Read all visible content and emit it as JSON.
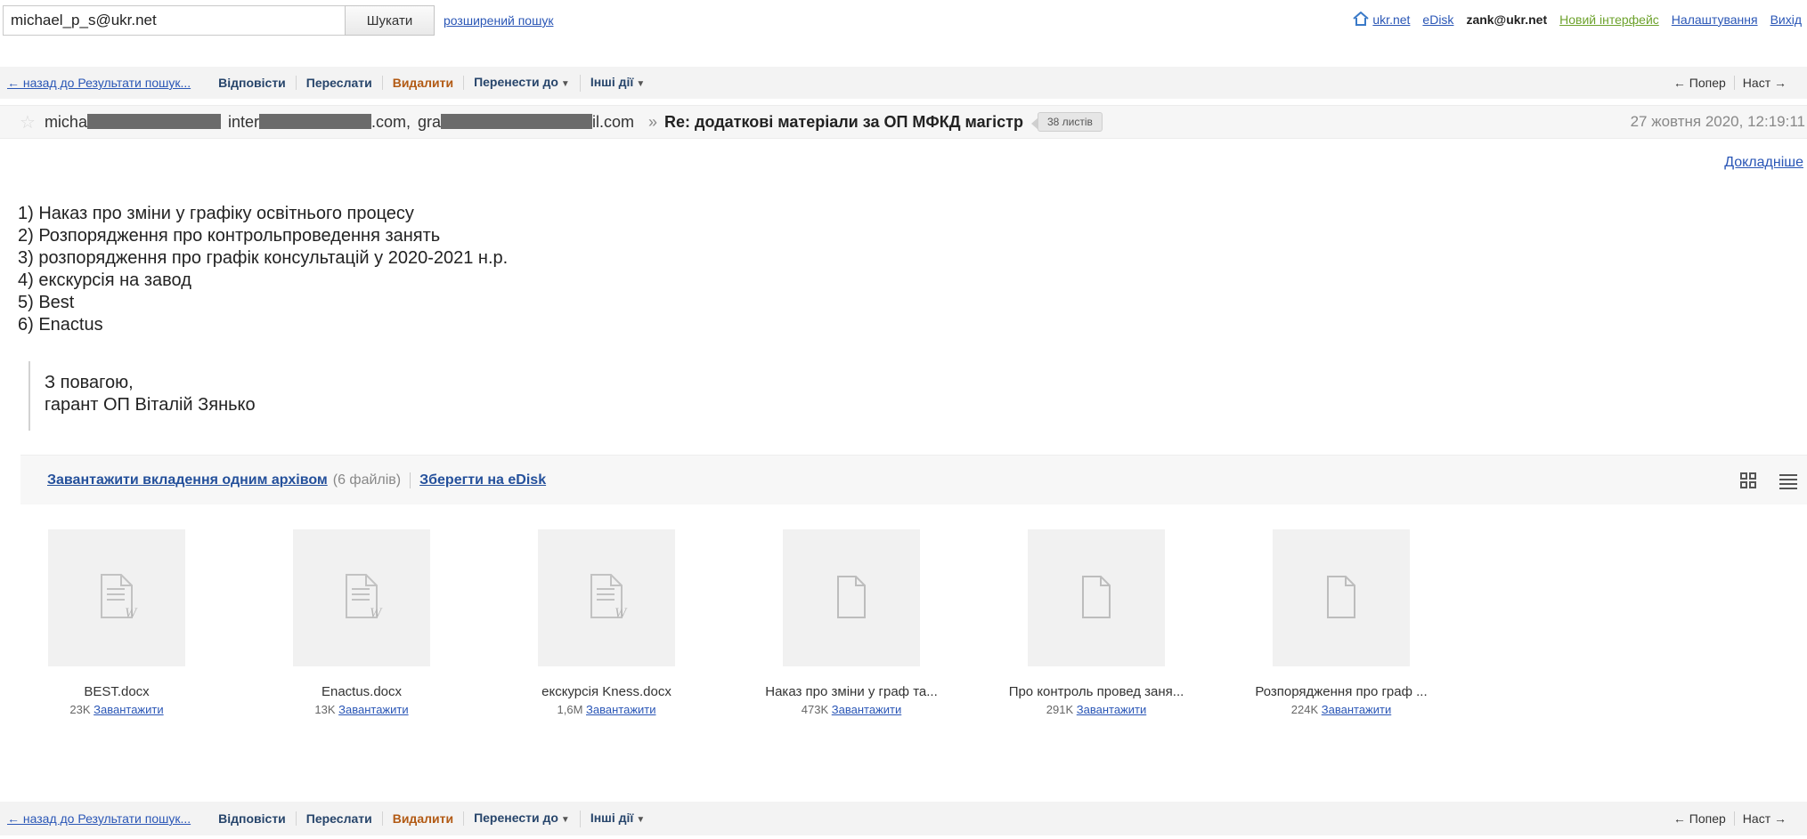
{
  "topbar": {
    "search_value": "michael_p_s@ukr.net",
    "search_button": "Шукати",
    "advanced_search": "розширений пошук",
    "links": {
      "home": "ukr.net",
      "edisk": "eDisk",
      "account": "zank@ukr.net",
      "new_interface": "Новий інтерфейс",
      "settings": "Налаштування",
      "exit": "Вихід"
    }
  },
  "toolbar": {
    "back": "← назад до Результати пошук...",
    "reply": "Відповісти",
    "forward": "Переслати",
    "delete": "Видалити",
    "move_to": "Перенести до",
    "other_actions": "Інші дії",
    "prev": "← Попер",
    "next": "Наст →"
  },
  "message": {
    "from": "micha",
    "to_1_prefix": "inter",
    "to_1_suffix": ".com,",
    "to_2_prefix": "gra",
    "to_2_suffix": "il.com",
    "separator": "»",
    "subject": "Re: додаткові матеріали за ОП МФКД магістр",
    "thread_count": "38 листів",
    "date": "27 жовтня 2020, 12:19:11",
    "details": "Докладніше",
    "body_lines": [
      "1) Наказ про зміни у графіку освітнього процесу",
      "2) Розпорядження про контрольпроведення занять",
      "3) розпорядження про графік консультацій у 2020-2021 н.р.",
      "4) екскурсія на завод",
      "5) Best",
      "6) Enactus"
    ],
    "signature_lines": [
      "З повагою,",
      "гарант ОП Віталій Зянько"
    ]
  },
  "attachments": {
    "download_all": "Завантажити вкладення одним архівом",
    "files_count": "(6 файлів)",
    "save_edisk": "Зберегти на eDisk",
    "download_label": "Завантажити",
    "files": [
      {
        "name": "BEST.docx",
        "size": "23K",
        "icon": "word-doc-icon"
      },
      {
        "name": "Enactus.docx",
        "size": "13K",
        "icon": "word-doc-icon"
      },
      {
        "name": "екскурсія Kness.docx",
        "size": "1,6M",
        "icon": "word-doc-icon"
      },
      {
        "name": "Наказ про зміни у граф та...",
        "size": "473K",
        "icon": "blank-doc-icon"
      },
      {
        "name": "Про контроль провед заня...",
        "size": "291K",
        "icon": "blank-doc-icon"
      },
      {
        "name": "Розпорядження про граф ...",
        "size": "224K",
        "icon": "blank-doc-icon"
      }
    ]
  }
}
